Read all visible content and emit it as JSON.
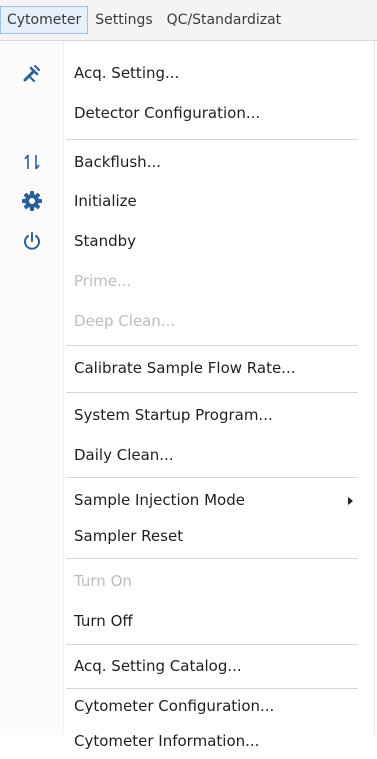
{
  "menubar": {
    "items": [
      {
        "label": "Cytometer"
      },
      {
        "label": "Settings"
      },
      {
        "label": "QC/Standardizat"
      }
    ]
  },
  "menu": {
    "items": [
      {
        "label": "Acq. Setting...",
        "icon": "wrench-icon"
      },
      {
        "label": "Detector Configuration..."
      },
      {
        "label": "Backflush...",
        "icon": "backflush-icon"
      },
      {
        "label": "Initialize",
        "icon": "gear-icon"
      },
      {
        "label": "Standby",
        "icon": "power-icon"
      },
      {
        "label": "Prime..."
      },
      {
        "label": "Deep Clean..."
      },
      {
        "label": "Calibrate Sample Flow Rate..."
      },
      {
        "label": "System Startup Program..."
      },
      {
        "label": "Daily Clean..."
      },
      {
        "label": "Sample Injection Mode"
      },
      {
        "label": "Sampler Reset"
      },
      {
        "label": "Turn On"
      },
      {
        "label": "Turn Off"
      },
      {
        "label": "Acq. Setting Catalog..."
      },
      {
        "label": "Cytometer Configuration..."
      },
      {
        "label": "Cytometer Information..."
      }
    ]
  },
  "colors": {
    "text": "#1f1f1f",
    "disabled_text": "#bdbdbd",
    "icon_blue": "#2a5f9a",
    "menubar_bg": "#f4f4f4",
    "active_tab_bg": "#e6f0fb"
  }
}
